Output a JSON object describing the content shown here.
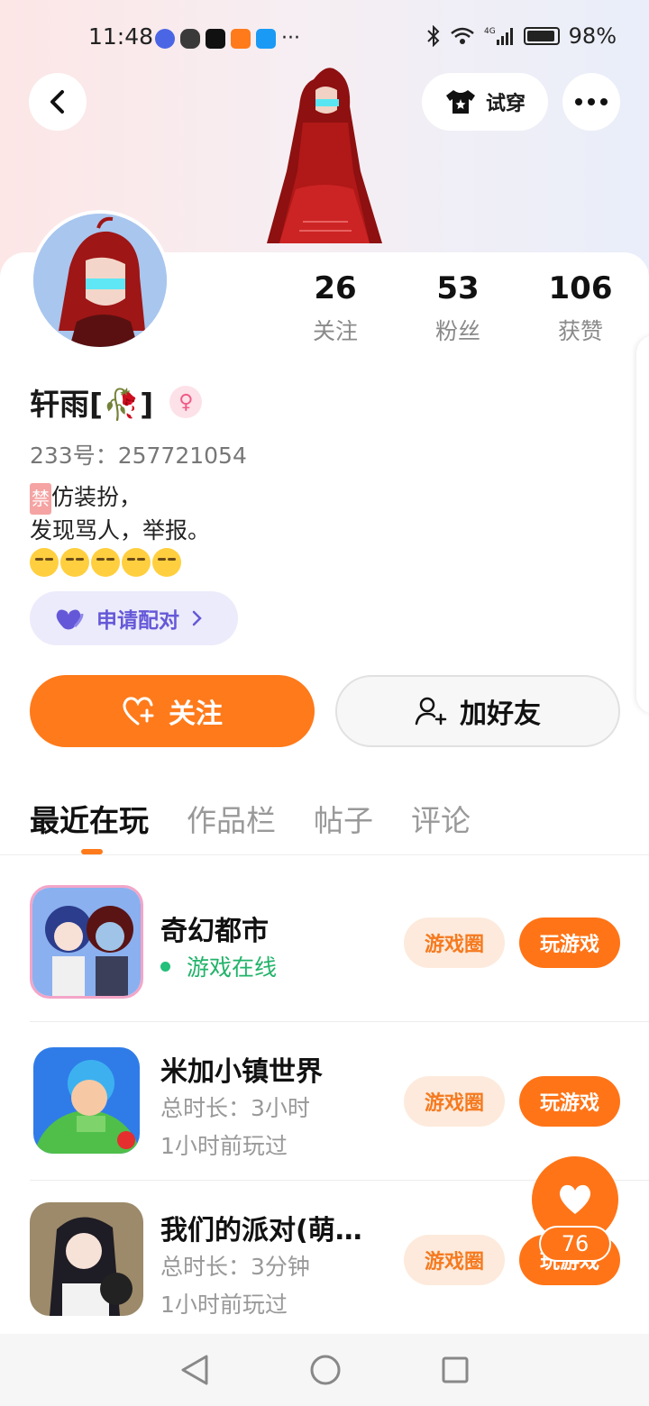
{
  "status_bar": {
    "time": "11:48",
    "battery": "98%",
    "network": "4G"
  },
  "header": {
    "back_icon": "chevron-left-icon",
    "tryon_label": "试穿",
    "tryon_icon": "tshirt-icon",
    "more_icon": "more-dots-icon"
  },
  "profile": {
    "name": "轩雨[🥀]",
    "gender_icon": "female-icon",
    "uid": "233号：257721054",
    "bio_tag": "禁",
    "bio_line1": "仿装扮，",
    "bio_line2": "发现骂人，举报。",
    "stats": [
      {
        "num": "26",
        "label": "关注"
      },
      {
        "num": "53",
        "label": "粉丝"
      },
      {
        "num": "106",
        "label": "获赞"
      }
    ]
  },
  "pair_button": "申请配对",
  "actions": {
    "follow": "关注",
    "add_friend": "加好友"
  },
  "tabs": [
    "最近在玩",
    "作品栏",
    "帖子",
    "评论"
  ],
  "games": [
    {
      "title": "奇幻都市",
      "status": "游戏在线",
      "circle": "游戏圈",
      "play": "玩游戏"
    },
    {
      "title": "米加小镇世界",
      "duration": "总时长：3小时",
      "last": "1小时前玩过",
      "circle": "游戏圈",
      "play": "玩游戏"
    },
    {
      "title": "我们的派对(萌…",
      "duration": "总时长：3分钟",
      "last": "1小时前玩过",
      "circle": "游戏圈",
      "play": "玩游戏"
    }
  ],
  "fab": {
    "count": "76"
  },
  "colors": {
    "accent": "#ff7417",
    "purple": "#6558d8",
    "online": "#22b36a"
  }
}
